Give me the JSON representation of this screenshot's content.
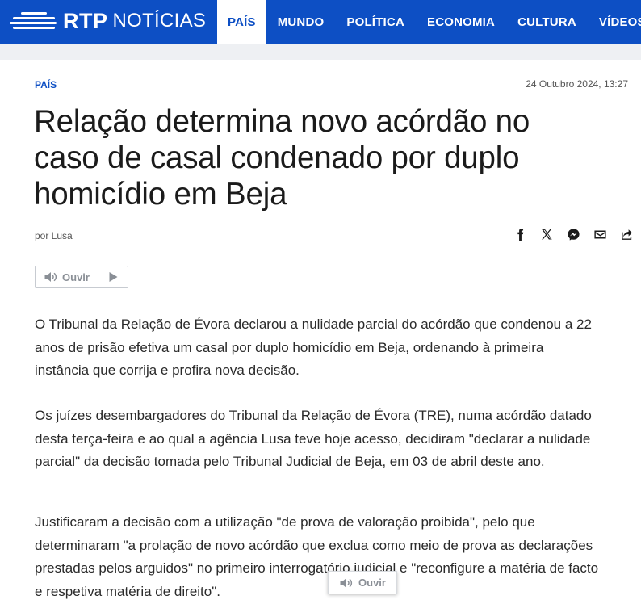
{
  "brand": {
    "logo_rtp": "RTP",
    "logo_noticias": "NOTÍCIAS",
    "primary_color": "#0d4fc4"
  },
  "nav": {
    "items": [
      {
        "label": "PAÍS",
        "active": true
      },
      {
        "label": "MUNDO",
        "active": false
      },
      {
        "label": "POLÍTICA",
        "active": false
      },
      {
        "label": "ECONOMIA",
        "active": false
      },
      {
        "label": "CULTURA",
        "active": false
      },
      {
        "label": "VÍDEOS",
        "active": false
      }
    ]
  },
  "article": {
    "section": "PAÍS",
    "date": "24 Outubro 2024, 13:27",
    "title": "Relação determina novo acórdão no caso de casal condenado por duplo homicídio em Beja",
    "author": "por Lusa",
    "listen_label": "Ouvir",
    "paragraphs": [
      "O Tribunal da Relação de Évora declarou a nulidade parcial do acórdão que condenou a 22 anos de prisão efetiva um casal por duplo homicídio em Beja, ordenando à primeira instância que corrija e profira nova decisão.",
      "Os juízes desembargadores do Tribunal da Relação de Évora (TRE), numa acórdão datado desta terça-feira e ao qual a agência Lusa teve hoje acesso, decidiram \"declarar a nulidade parcial\" da decisão tomada pelo Tribunal Judicial de Beja, em 03 de abril deste ano.",
      "Justificaram a decisão com a utilização \"de prova de valoração proibida\", pelo que determinaram \"a prolação de novo acórdão que exclua como meio de prova as declarações prestadas pelos arguidos\" no primeiro interrogatório judicial e \"reconfigure a matéria de facto e respetiva matéria de direito\"."
    ]
  },
  "share": {
    "icons": [
      "facebook-icon",
      "x-icon",
      "messenger-icon",
      "email-icon",
      "share-icon"
    ]
  },
  "floating_player": {
    "label": "Ouvir"
  }
}
